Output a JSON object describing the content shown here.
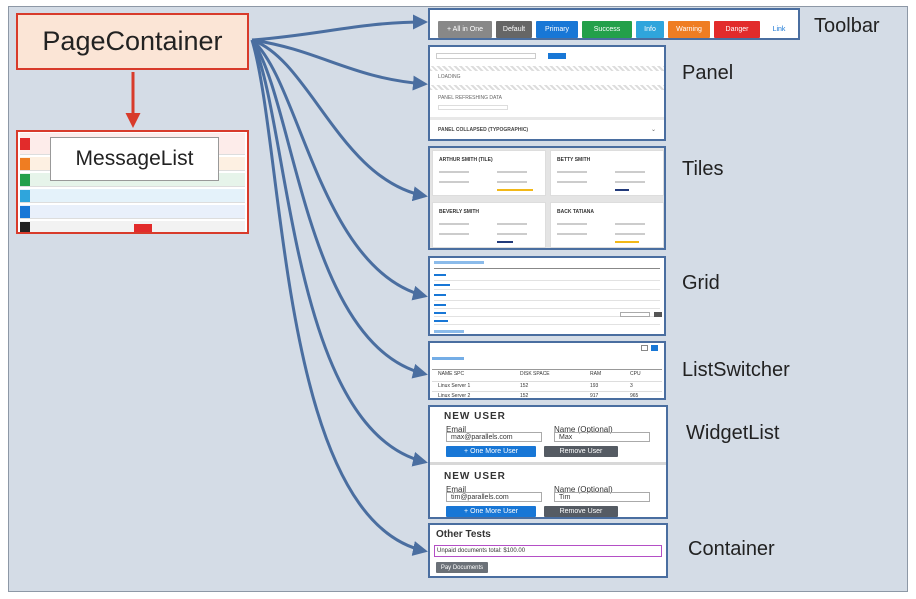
{
  "labels": {
    "page_container": "PageContainer",
    "message_list": "MessageList",
    "toolbar": "Toolbar",
    "panel": "Panel",
    "tiles": "Tiles",
    "grid": "Grid",
    "list_switcher": "ListSwitcher",
    "widget_list": "WidgetList",
    "container": "Container"
  },
  "toolbar": {
    "buttons": [
      {
        "label": "+ All in One",
        "color": "#888888"
      },
      {
        "label": "Default",
        "color": "#666666"
      },
      {
        "label": "Primary",
        "color": "#1877d6"
      },
      {
        "label": "Success",
        "color": "#23a04a"
      },
      {
        "label": "Info",
        "color": "#2fa5dc"
      },
      {
        "label": "Warning",
        "color": "#ef7d22"
      },
      {
        "label": "Danger",
        "color": "#e22b2b"
      }
    ],
    "link_label": "Link"
  },
  "panel": {
    "loading": "LOADING",
    "refreshing": "PANEL REFRESHING DATA",
    "collapsed": "PANEL COLLAPSED (TYPOGRAPHIC)"
  },
  "tiles": [
    {
      "name": "ARTHUR SMITH (TILE)"
    },
    {
      "name": "BETTY SMITH"
    },
    {
      "name": "BEVERLY SMITH"
    },
    {
      "name": "BACK TATIANA"
    }
  ],
  "list_switcher": {
    "columns": [
      "NAME SPC",
      "DISK SPACE",
      "RAM",
      "CPU"
    ],
    "rows": [
      [
        "Linux Server 1",
        "152",
        "193",
        "3"
      ],
      [
        "Linux Server 2",
        "152",
        "917",
        "965"
      ]
    ]
  },
  "widget_list": {
    "blocks": [
      {
        "title": "NEW USER",
        "email_label": "Email",
        "email_value": "max@parallels.com",
        "name_label": "Name (Optional)",
        "name_value": "Max",
        "add_label": "+ One More User",
        "remove_label": "Remove User"
      },
      {
        "title": "NEW USER",
        "email_label": "Email",
        "email_value": "tim@parallels.com",
        "name_label": "Name (Optional)",
        "name_value": "Tim",
        "add_label": "+ One More User",
        "remove_label": "Remove User"
      }
    ]
  },
  "container": {
    "title": "Other Tests",
    "notice": "Unpaid documents total: $100.00",
    "button": "Pay Documents"
  },
  "colors": {
    "background": "#d4dce6",
    "arrow_red": "#d83b2b",
    "arrow_blue": "#4a6ea0",
    "page_container_fill": "#fbe5d6"
  }
}
